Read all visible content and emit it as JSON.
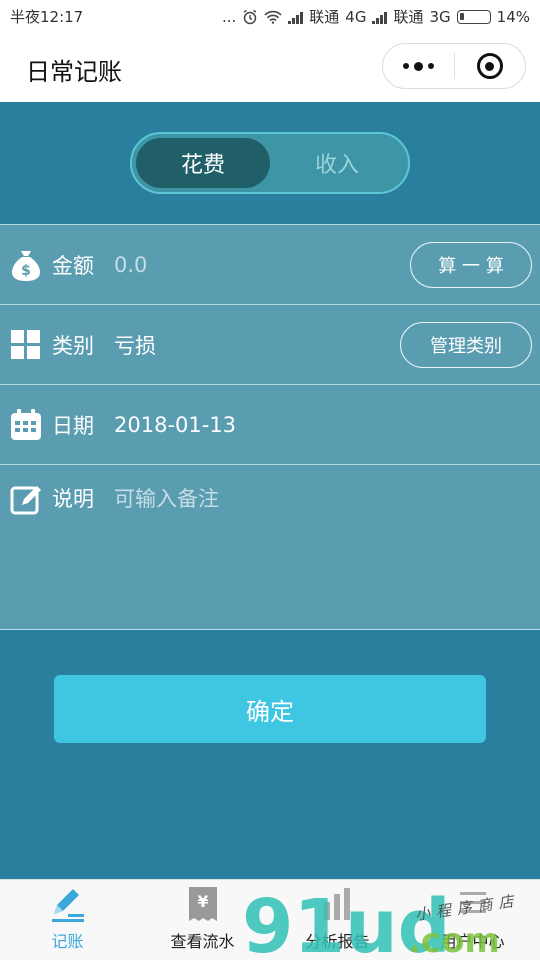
{
  "status_bar": {
    "time": "半夜12:17",
    "dots": "...",
    "carrier1": "联通",
    "network1": "4G",
    "carrier2": "联通",
    "network2": "3G",
    "battery": "14%",
    "battery_level": 0.14
  },
  "title_bar": {
    "title": "日常记账",
    "more_icon": "more-dots-icon",
    "close_icon": "target-circle-icon"
  },
  "type_toggle": {
    "options": [
      "花费",
      "收入"
    ],
    "selected": "花费"
  },
  "form": {
    "amount": {
      "label": "金额",
      "placeholder": "0.0",
      "button": "算 一 算",
      "icon": "money-bag-icon"
    },
    "category": {
      "label": "类别",
      "value": "亏损",
      "button": "管理类别",
      "icon": "grid-icon"
    },
    "date": {
      "label": "日期",
      "value": "2018-01-13",
      "icon": "calendar-icon"
    },
    "note": {
      "label": "说明",
      "placeholder": "可输入备注",
      "icon": "edit-icon"
    }
  },
  "confirm_button": "确定",
  "tab_bar": {
    "tabs": [
      {
        "label": "记账",
        "icon": "pencil-icon",
        "active": true
      },
      {
        "label": "查看流水",
        "icon": "yen-receipt-icon",
        "active": false
      },
      {
        "label": "分析报告",
        "icon": "report-icon",
        "active": false
      },
      {
        "label": "用户中心",
        "icon": "user-icon",
        "active": false
      }
    ]
  },
  "watermark": {
    "logo_text": "91ud",
    "suffix": ".com",
    "handwriting": "小程序商店"
  },
  "colors": {
    "main_bg": "#2b7f9e",
    "form_bg": "#5a9db1",
    "toggle_active": "#215f68",
    "confirm": "#3ec6e3",
    "tab_active": "#3aa9d9",
    "watermark_teal": "#2fc1b6",
    "watermark_green": "#7cc13b"
  }
}
